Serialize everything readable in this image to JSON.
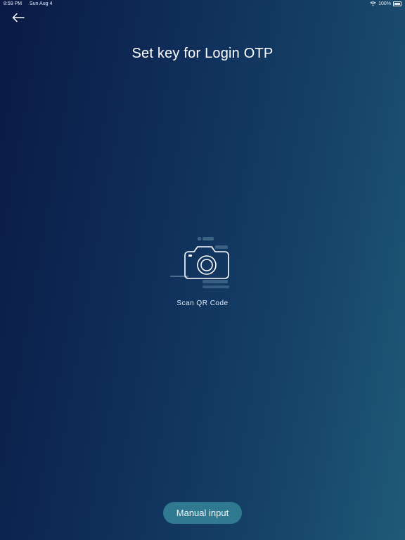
{
  "status_bar": {
    "time": "8:59 PM",
    "date": "Sun Aug 4",
    "battery": "100%"
  },
  "header": {
    "back_icon": "arrow-left-icon",
    "title": "Set key for Login OTP"
  },
  "scan": {
    "icon": "camera-icon",
    "label": "Scan QR Code"
  },
  "footer": {
    "manual_input_label": "Manual input"
  },
  "colors": {
    "background_start": "#0a1a44",
    "background_end": "#1f5a78",
    "button_bg": "#2f7a90",
    "text": "#ffffff"
  }
}
